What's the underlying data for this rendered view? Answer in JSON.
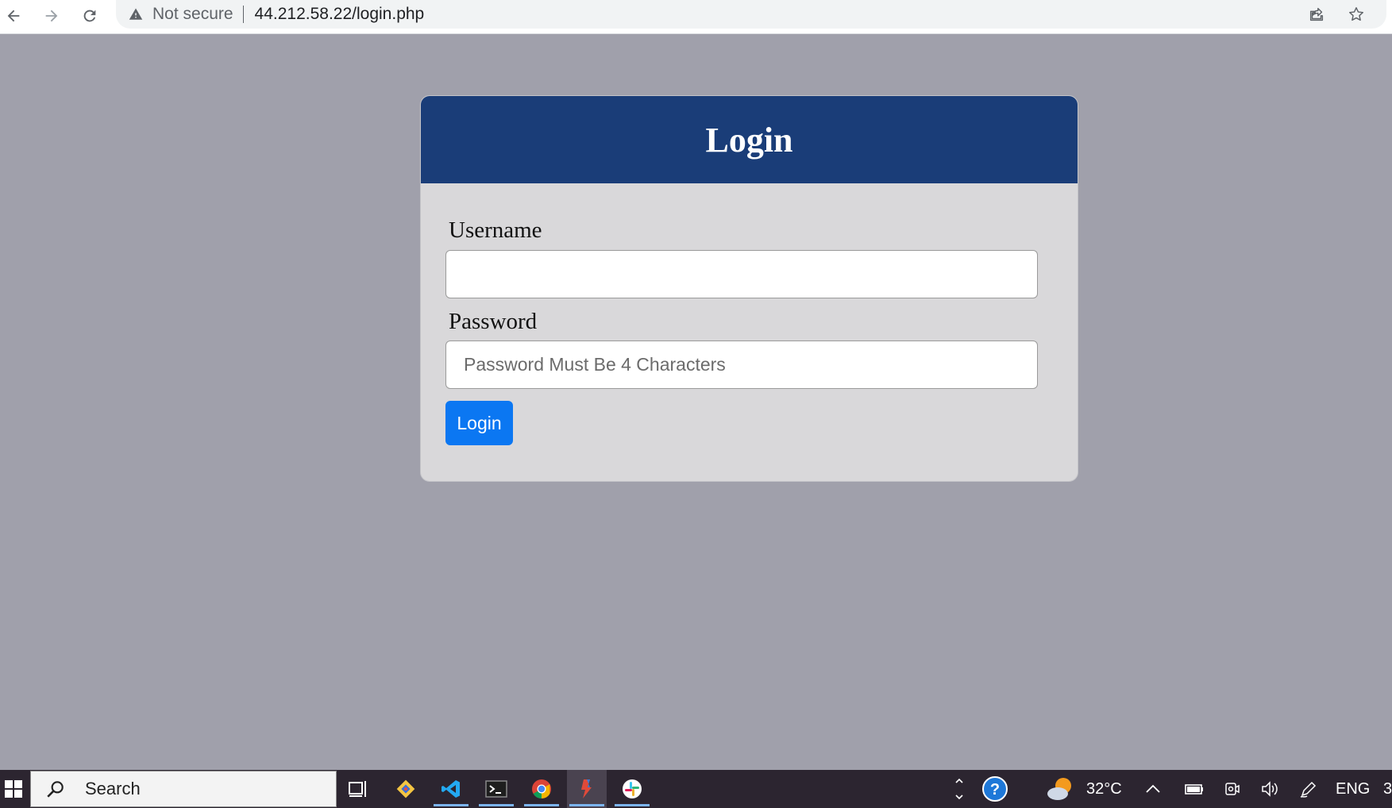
{
  "browser": {
    "security_label": "Not secure",
    "url": "44.212.58.22/login.php"
  },
  "login": {
    "title": "Login",
    "username_label": "Username",
    "username_value": "",
    "password_label": "Password",
    "password_placeholder": "Password Must Be 4 Characters",
    "submit_label": "Login"
  },
  "colors": {
    "page_background": "#a0a0ab",
    "header": "#1a3d78",
    "card": "#d9d8da",
    "button": "#0b77f2"
  },
  "taskbar": {
    "search_label": "Search",
    "pinned_apps": [
      "task-view",
      "git",
      "vs-code",
      "terminal",
      "chrome",
      "app",
      "slack"
    ],
    "weather_temp": "32°C",
    "language": "ENG",
    "clock_partial": "3"
  }
}
